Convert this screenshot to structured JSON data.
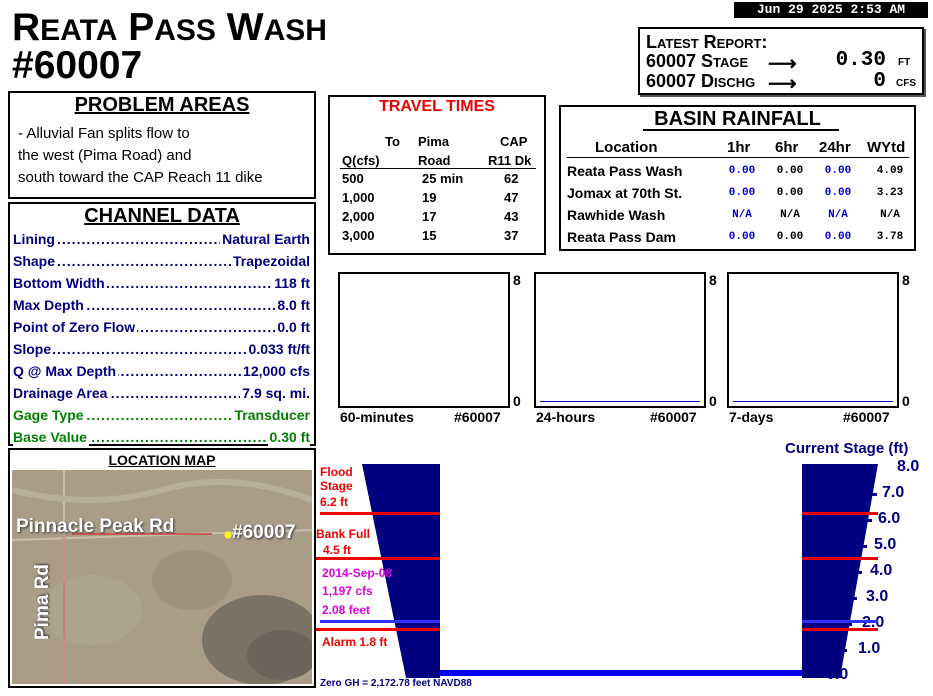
{
  "header": {
    "title_line1_first": "R",
    "title_line1_small": "EATA",
    "title_line1_p": "P",
    "title_line1_small2": "ASS",
    "title_line1_w": "W",
    "title_line1_small3": "ASH",
    "title_line2": "#60007",
    "datetime": "Jun 29 2025  2:53 AM"
  },
  "latest_report": {
    "heading": "Latest Report:",
    "stage_label": "60007 Stage",
    "stage_value": "0.30",
    "stage_unit": "FT",
    "discharge_label": "60007 Dischg",
    "discharge_value": "0",
    "discharge_unit": "CFS",
    "arrow": "⟶"
  },
  "problem_areas": {
    "heading": "PROBLEM AREAS",
    "text": "- Alluvial Fan splits flow to\nthe west (Pima Road) and\nsouth toward the CAP Reach 11 dike"
  },
  "channel_data": {
    "heading": "CHANNEL DATA",
    "rows": [
      {
        "label": "Lining",
        "value": "Natural Earth",
        "color": "#000080"
      },
      {
        "label": "Shape",
        "value": "Trapezoidal",
        "color": "#000080"
      },
      {
        "label": "Bottom Width",
        "value": "118 ft",
        "color": "#000080"
      },
      {
        "label": "Max Depth",
        "value": "8.0 ft",
        "color": "#000080"
      },
      {
        "label": "Point of Zero Flow",
        "value": "0.0 ft",
        "color": "#000080"
      },
      {
        "label": "Slope",
        "value": "0.033 ft/ft",
        "color": "#000080"
      },
      {
        "label": "Q @ Max Depth",
        "value": "12,000 cfs",
        "color": "#000080"
      },
      {
        "label": "Drainage Area",
        "value": "7.9 sq. mi.",
        "color": "#000080"
      },
      {
        "label": "Gage Type",
        "value": "Transducer",
        "color": "#008000"
      },
      {
        "label": "Base Value",
        "value": "0.30 ft",
        "color": "#008000"
      }
    ]
  },
  "location_map": {
    "heading": "LOCATION MAP",
    "road1": "Pinnacle Peak Rd",
    "road2": "Pima Rd",
    "gage": "#60007"
  },
  "travel_times": {
    "heading": "TRAVEL TIMES",
    "col_to": "To",
    "col_pima1": "Pima",
    "col_pima2": "Road",
    "col_cap1": "CAP",
    "col_cap2": "R11 Dk",
    "col_q": "Q(cfs)",
    "rows": [
      {
        "q": "500",
        "pima": "25 min",
        "cap": "62"
      },
      {
        "q": "1,000",
        "pima": "19",
        "cap": "47"
      },
      {
        "q": "2,000",
        "pima": "17",
        "cap": "43"
      },
      {
        "q": "3,000",
        "pima": "15",
        "cap": "37"
      }
    ]
  },
  "basin_rainfall": {
    "heading": "BASIN RAINFALL",
    "columns": [
      "Location",
      "1hr",
      "6hr",
      "24hr",
      "WYtd"
    ],
    "rows": [
      {
        "location": "Reata Pass Wash",
        "h1": "0.00",
        "h6": "0.00",
        "h24": "0.00",
        "wytd": "4.09"
      },
      {
        "location": "Jomax at 70th St.",
        "h1": "0.00",
        "h6": "0.00",
        "h24": "0.00",
        "wytd": "3.23"
      },
      {
        "location": "Rawhide Wash",
        "h1": "N/A",
        "h6": "N/A",
        "h24": "N/A",
        "wytd": "N/A"
      },
      {
        "location": "Reata Pass Dam",
        "h1": "0.00",
        "h6": "0.00",
        "h24": "0.00",
        "wytd": "3.78"
      }
    ],
    "blue": "#0000cc"
  },
  "sparks": [
    {
      "label": "60-minutes",
      "id": "#60007",
      "top_value": "8",
      "bottom_value": "0"
    },
    {
      "label": "24-hours",
      "id": "#60007",
      "top_value": "8",
      "bottom_value": "0"
    },
    {
      "label": "7-days",
      "id": "#60007",
      "top_value": "8",
      "bottom_value": "0"
    }
  ],
  "stage_gauge": {
    "heading": "Current Stage (ft)",
    "ticks": [
      "8.0",
      "7.0",
      "6.0",
      "5.0",
      "4.0",
      "3.0",
      "2.0",
      "1.0",
      "0.0"
    ],
    "current_stage": 0.3,
    "max_stage": 8.0,
    "flood_label1": "Flood",
    "flood_label2": "Stage",
    "flood_value": "6.2 ft",
    "bankfull_label": "Bank Full",
    "bankfull_value": "4.5 ft",
    "record_date": "2014-Sep-08",
    "record_cfs": "1,197 cfs",
    "record_feet": "2.08 feet",
    "alarm_label": "Alarm 1.8 ft",
    "zero_gh": "Zero GH = 2,172.78 feet NAVD88"
  }
}
